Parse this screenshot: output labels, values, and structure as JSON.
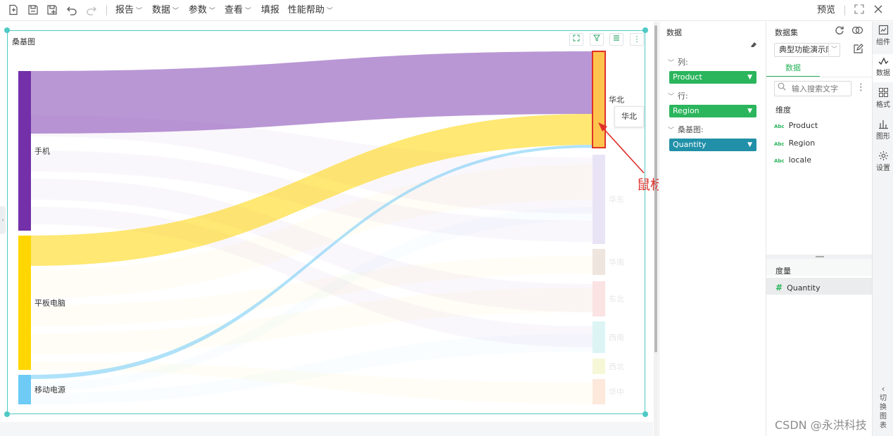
{
  "toolbar": {
    "icons": [
      "new-report-icon",
      "save-icon",
      "save-as-icon",
      "undo-icon",
      "redo-icon"
    ],
    "menus": [
      {
        "label": "报告",
        "has_caret": true
      },
      {
        "label": "数据",
        "has_caret": true
      },
      {
        "label": "参数",
        "has_caret": true
      },
      {
        "label": "查看",
        "has_caret": true
      },
      {
        "label": "填报",
        "has_caret": false
      },
      {
        "label": "性能帮助",
        "has_caret": true
      }
    ],
    "preview": "预览"
  },
  "widget": {
    "title": "桑基图",
    "buttons": [
      "expand-icon",
      "filter-icon",
      "list-icon",
      "more-icon"
    ]
  },
  "chart_data": {
    "type": "sankey",
    "sources": [
      {
        "name": "手机",
        "color": "#7330a9"
      },
      {
        "name": "平板电脑",
        "color": "#ffd600"
      },
      {
        "name": "移动电源",
        "color": "#6dcbf6"
      }
    ],
    "targets": [
      "华北",
      "华东",
      "华南",
      "东北",
      "西南",
      "西北",
      "华中"
    ],
    "target_colors": [
      "#ffc44d",
      "#e9e4f5",
      "#ede5de",
      "#fbe3e3",
      "#dcf5f4",
      "#f5f7d7",
      "#fde8dc"
    ],
    "highlighted_target": "华北",
    "tooltip": "华北"
  },
  "data_panel": {
    "title": "数据",
    "column_label": "列:",
    "column_value": "Product",
    "row_label": "行:",
    "row_value": "Region",
    "chart_label": "桑基图:",
    "chart_value": "Quantity",
    "colors": {
      "green": "#2bb55c",
      "teal": "#2190a8"
    }
  },
  "dataset_panel": {
    "label": "数据集",
    "selected": "典型功能演示库",
    "tab": "数据",
    "search_placeholder": "输入搜索文字",
    "dimension_title": "维度",
    "dimensions": [
      "Product",
      "Region",
      "locale"
    ],
    "field_type": "Abc",
    "measure_title": "度量",
    "measure_symbol": "#",
    "measures": [
      "Quantity"
    ]
  },
  "rail": {
    "items": [
      {
        "icon": "chart-component-icon",
        "label": "组件"
      },
      {
        "icon": "data-wave-icon",
        "label": "数据"
      },
      {
        "icon": "format-grid-icon",
        "label": "格式"
      },
      {
        "icon": "shape-bars-icon",
        "label": "图形"
      },
      {
        "icon": "settings-gear-icon",
        "label": "设置"
      }
    ],
    "switch_label": [
      "切",
      "换",
      "图",
      "表"
    ]
  },
  "annotation": "鼠标停留在该区域",
  "watermark": "CSDN @永洪科技"
}
